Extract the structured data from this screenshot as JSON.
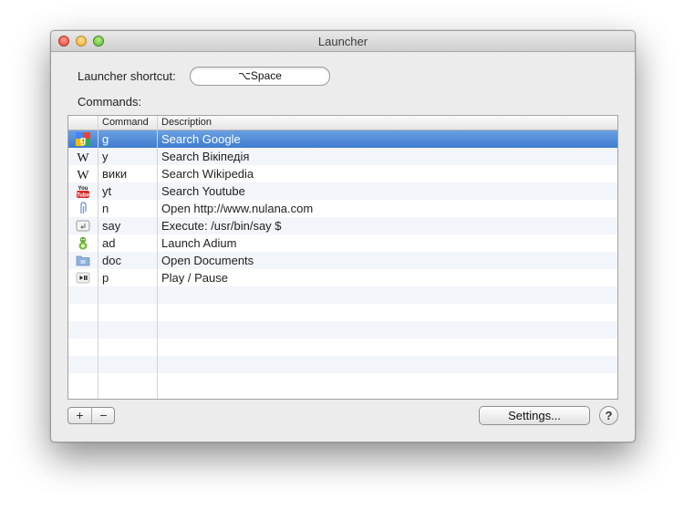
{
  "window": {
    "title": "Launcher"
  },
  "shortcut": {
    "label": "Launcher shortcut:",
    "value": "⌥Space"
  },
  "commands_label": "Commands:",
  "table": {
    "headers": {
      "icon": "",
      "command": "Command",
      "description": "Description"
    },
    "rows": [
      {
        "icon": "google-icon",
        "command": "g",
        "description": "Search Google",
        "selected": true
      },
      {
        "icon": "wikipedia-icon",
        "command": "y",
        "description": "Search Вікіпедія"
      },
      {
        "icon": "wikipedia-icon",
        "command": "вики",
        "description": "Search Wikipedia"
      },
      {
        "icon": "youtube-icon",
        "command": "yt",
        "description": "Search Youtube"
      },
      {
        "icon": "link-icon",
        "command": "n",
        "description": "Open http://www.nulana.com"
      },
      {
        "icon": "terminal-icon",
        "command": "say",
        "description": "Execute: /usr/bin/say $"
      },
      {
        "icon": "adium-icon",
        "command": "ad",
        "description": "Launch Adium"
      },
      {
        "icon": "folder-icon",
        "command": "doc",
        "description": "Open Documents"
      },
      {
        "icon": "play-pause-icon",
        "command": "p",
        "description": "Play / Pause"
      }
    ],
    "empty_rows": 6
  },
  "buttons": {
    "add": "+",
    "remove": "−",
    "settings": "Settings...",
    "help": "?"
  },
  "colors": {
    "selection": "#4a86d6",
    "window": "#ececec"
  }
}
